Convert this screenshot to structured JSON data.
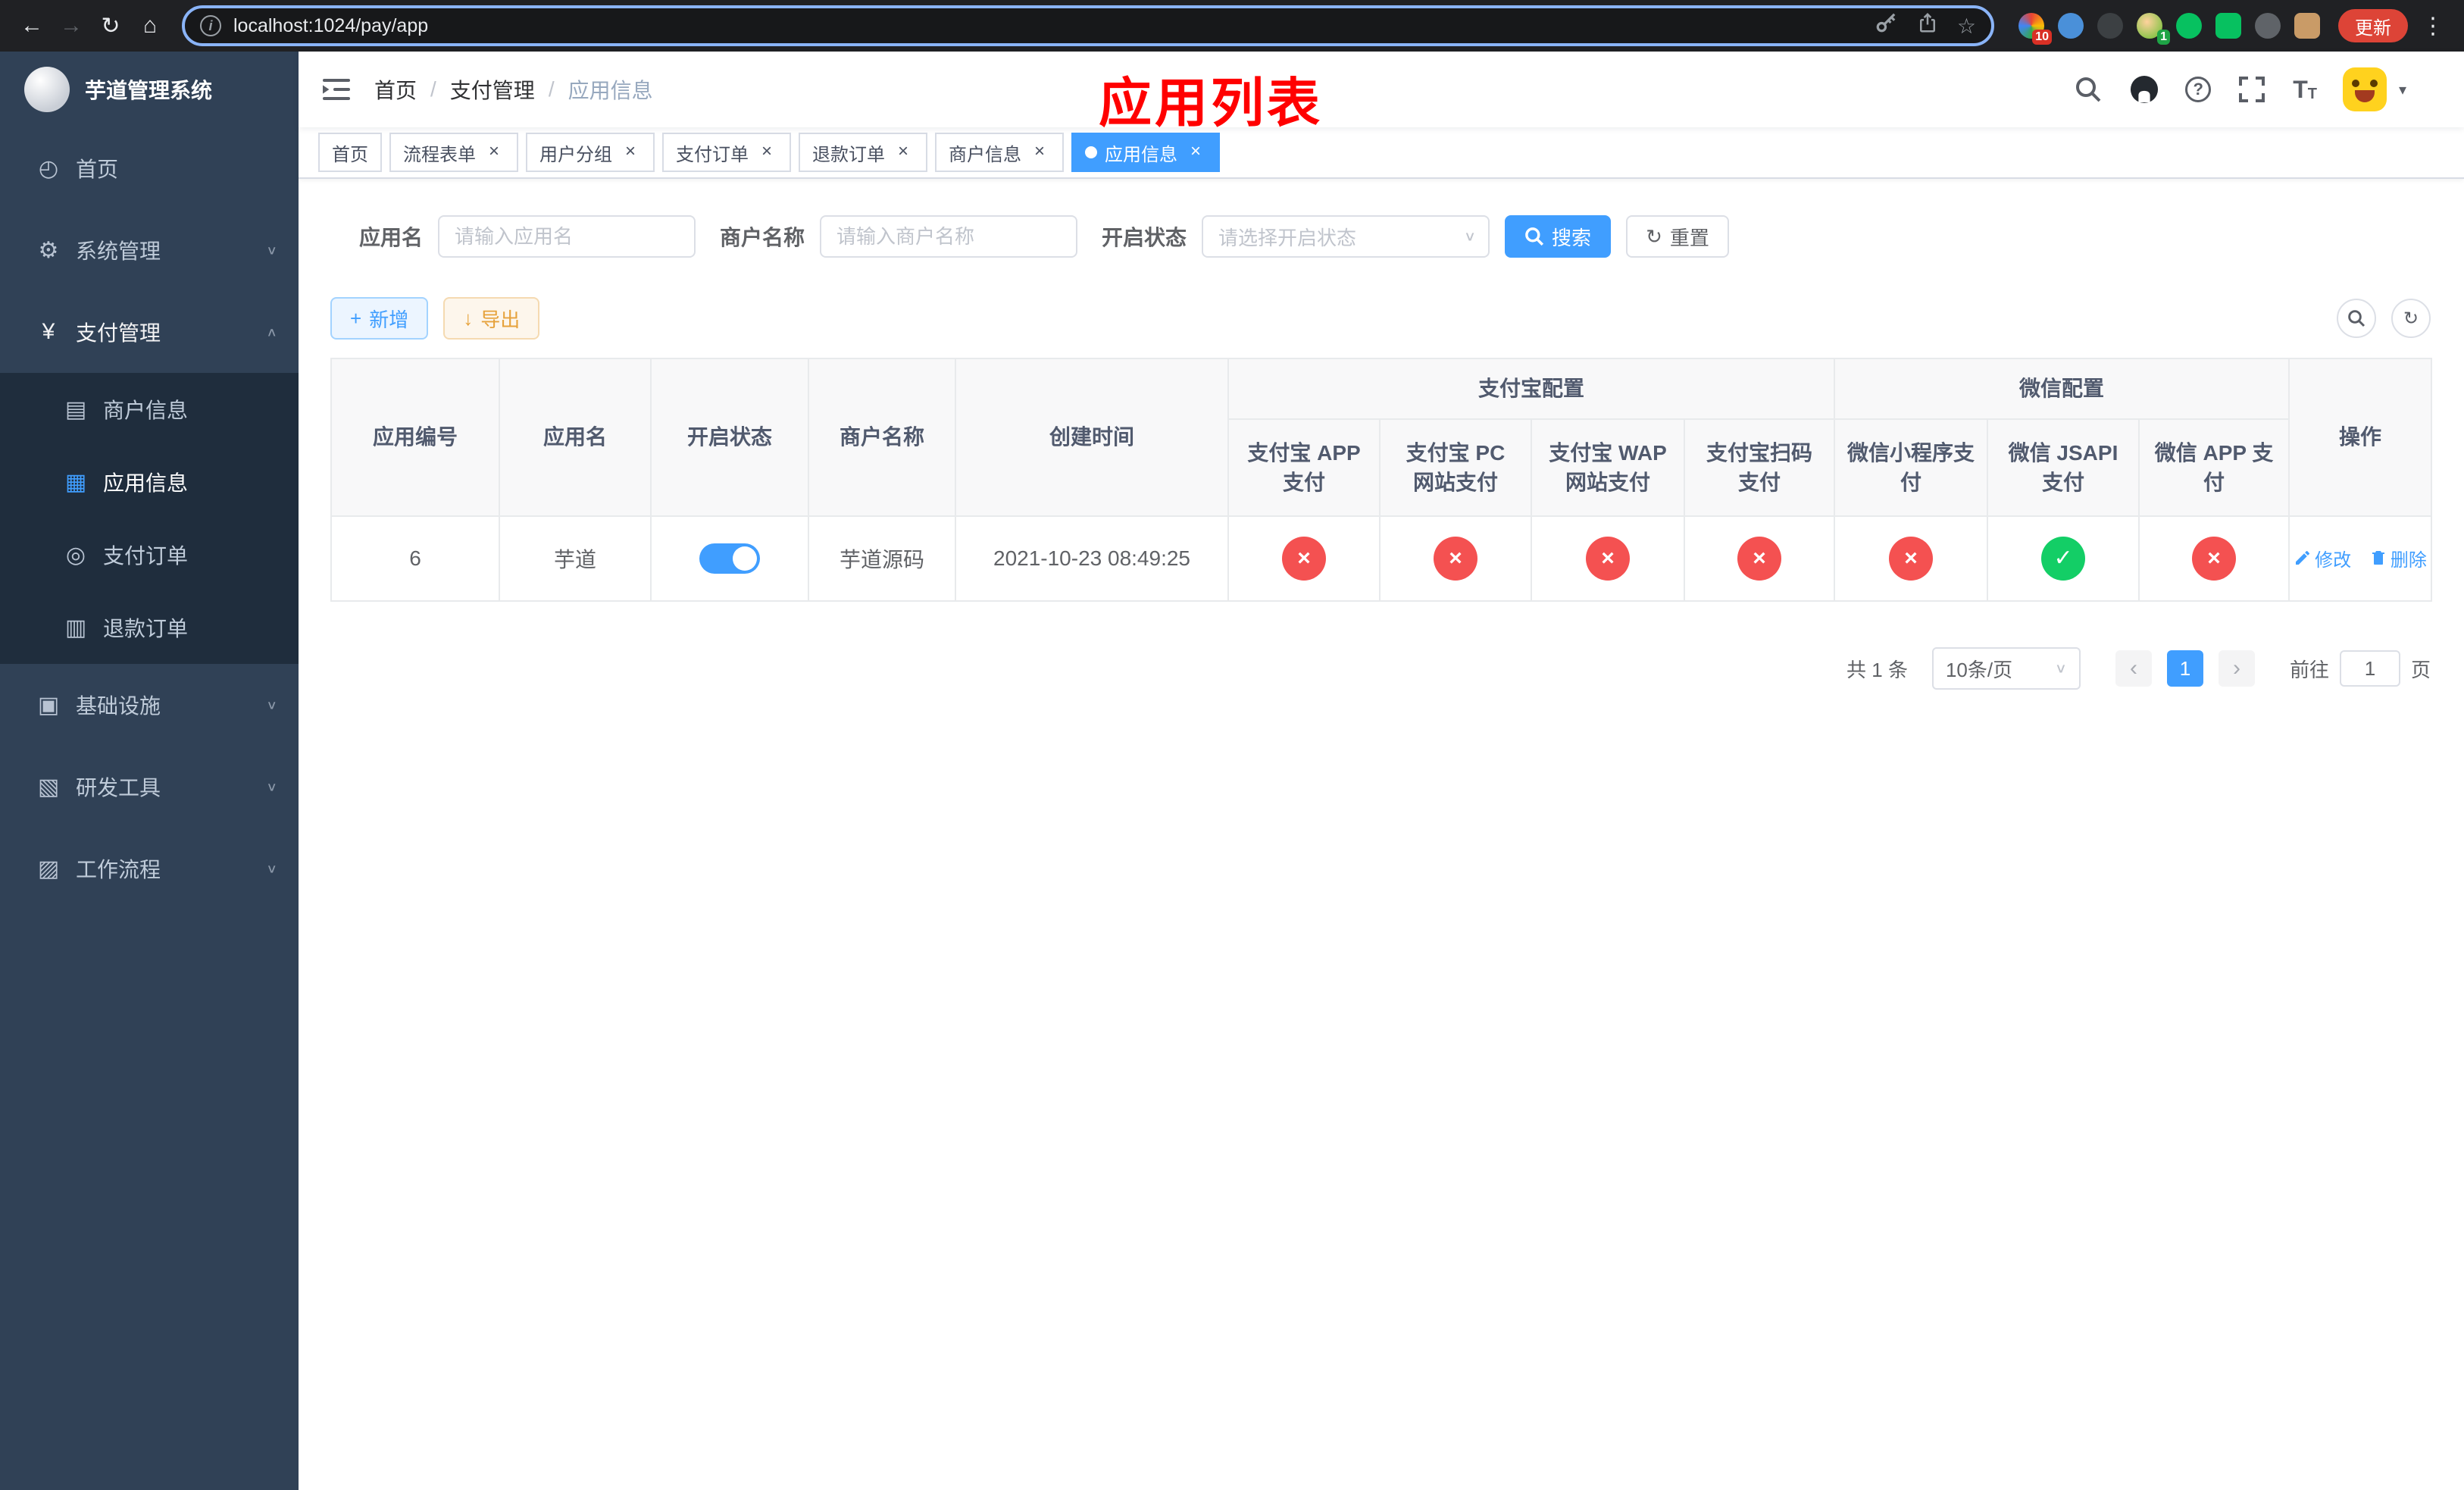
{
  "browser": {
    "url": "localhost:1024/pay/app",
    "update_label": "更新",
    "extension_badges": {
      "apps": "10",
      "profile": "1"
    }
  },
  "icons": {
    "back": "←",
    "forward": "→",
    "refresh": "↻",
    "home": "⌂",
    "star": "☆",
    "menu_dots": "⋮",
    "chevron_down": "∨",
    "chevron_up": "∧",
    "caret_down": "▾",
    "close": "×",
    "plus": "+",
    "download": "↓",
    "reset": "↻",
    "prev": "‹",
    "next": "›",
    "success": "✓",
    "fail": "×",
    "info": "i",
    "help": "?"
  },
  "colors": {
    "primary": "#409eff",
    "success": "#13ce66",
    "danger": "#f45151",
    "warning": "#e6a23c"
  },
  "sidebar": {
    "title": "芋道管理系统",
    "menu": [
      {
        "label": "首页",
        "icon": "◴"
      },
      {
        "label": "系统管理",
        "icon": "⚙"
      },
      {
        "label": "支付管理",
        "icon": "¥"
      },
      {
        "label": "基础设施",
        "icon": "▣"
      },
      {
        "label": "研发工具",
        "icon": "▧"
      },
      {
        "label": "工作流程",
        "icon": "▨"
      }
    ],
    "submenu": [
      {
        "label": "商户信息",
        "icon": "▤"
      },
      {
        "label": "应用信息",
        "icon": "▦"
      },
      {
        "label": "支付订单",
        "icon": "◎"
      },
      {
        "label": "退款订单",
        "icon": "▥"
      }
    ]
  },
  "header": {
    "breadcrumb": [
      "首页",
      "支付管理",
      "应用信息"
    ],
    "separator": "/",
    "overlay_title": "应用列表"
  },
  "tabs": [
    {
      "label": "首页"
    },
    {
      "label": "流程表单"
    },
    {
      "label": "用户分组"
    },
    {
      "label": "支付订单"
    },
    {
      "label": "退款订单"
    },
    {
      "label": "商户信息"
    },
    {
      "label": "应用信息"
    }
  ],
  "filters": {
    "app_name_label": "应用名",
    "app_name_placeholder": "请输入应用名",
    "merchant_label": "商户名称",
    "merchant_placeholder": "请输入商户名称",
    "status_label": "开启状态",
    "status_placeholder": "请选择开启状态",
    "search_label": "搜索",
    "reset_label": "重置"
  },
  "toolbar": {
    "add_label": "新增",
    "export_label": "导出"
  },
  "table": {
    "group_headers": {
      "alipay": "支付宝配置",
      "wechat": "微信配置"
    },
    "columns": {
      "id": "应用编号",
      "name": "应用名",
      "status": "开启状态",
      "merchant": "商户名称",
      "created": "创建时间",
      "alipay_app": "支付宝 APP 支付",
      "alipay_pc": "支付宝 PC 网站支付",
      "alipay_wap": "支付宝 WAP 网站支付",
      "alipay_qr": "支付宝扫码支付",
      "wx_mini": "微信小程序支付",
      "wx_jsapi": "微信 JSAPI 支付",
      "wx_app": "微信 APP 支付",
      "actions": "操作"
    },
    "row": {
      "id": "6",
      "name": "芋道",
      "enabled": true,
      "merchant": "芋道源码",
      "created": "2021-10-23 08:49:25",
      "statuses": [
        "fail",
        "fail",
        "fail",
        "fail",
        "fail",
        "success",
        "fail"
      ],
      "edit_label": "修改",
      "delete_label": "删除"
    }
  },
  "pagination": {
    "total_text": "共 1 条",
    "page_size": "10条/页",
    "current_page": "1",
    "goto_label": "前往",
    "goto_value": "1",
    "page_label": "页"
  }
}
